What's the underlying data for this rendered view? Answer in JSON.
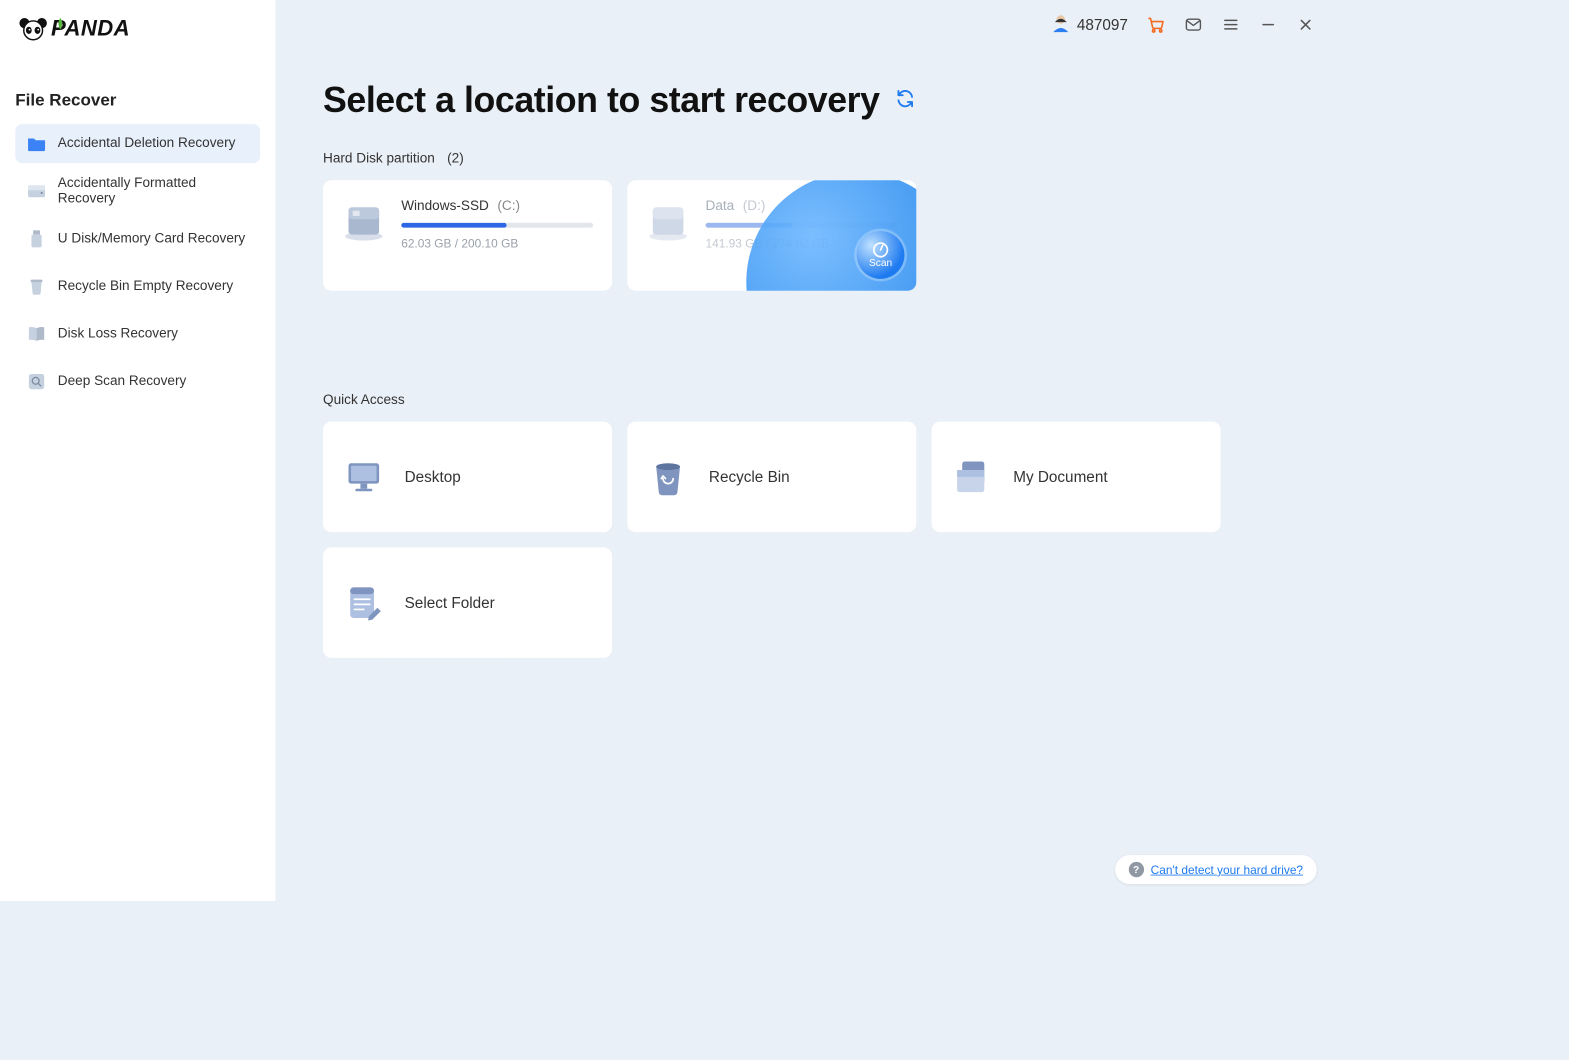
{
  "brand": "PANDA",
  "topbar": {
    "user_id": "487097"
  },
  "sidebar": {
    "title": "File Recover",
    "items": [
      {
        "label": "Accidental Deletion Recovery",
        "icon": "folder-icon",
        "active": true
      },
      {
        "label": "Accidentally Formatted Recovery",
        "icon": "drive-icon",
        "active": false
      },
      {
        "label": "U Disk/Memory Card Recovery",
        "icon": "usb-icon",
        "active": false
      },
      {
        "label": "Recycle Bin Empty Recovery",
        "icon": "trash-icon",
        "active": false
      },
      {
        "label": "Disk Loss Recovery",
        "icon": "book-icon",
        "active": false
      },
      {
        "label": "Deep Scan Recovery",
        "icon": "scan-icon",
        "active": false
      }
    ]
  },
  "main": {
    "title": "Select a location to start recovery",
    "partitions": {
      "label": "Hard Disk partition",
      "count": "(2)",
      "items": [
        {
          "name": "Windows-SSD",
          "letter": "(C:)",
          "usage_text": "62.03 GB / 200.10 GB",
          "fill_pct": 55,
          "fill_color": "#2e67e6",
          "hovered": false
        },
        {
          "name": "Data",
          "letter": "(D:)",
          "usage_text": "141.93 GB / 274.62 GB",
          "fill_pct": 45,
          "fill_color": "#9bb9f0",
          "hovered": true,
          "scan_label": "Scan"
        }
      ]
    },
    "quick": {
      "label": "Quick Access",
      "items": [
        {
          "label": "Desktop",
          "icon": "monitor-icon"
        },
        {
          "label": "Recycle Bin",
          "icon": "trash-icon"
        },
        {
          "label": "My Document",
          "icon": "documents-icon"
        },
        {
          "label": "Select Folder",
          "icon": "edit-file-icon"
        }
      ]
    }
  },
  "help": {
    "text": "Can't detect your hard drive?"
  }
}
